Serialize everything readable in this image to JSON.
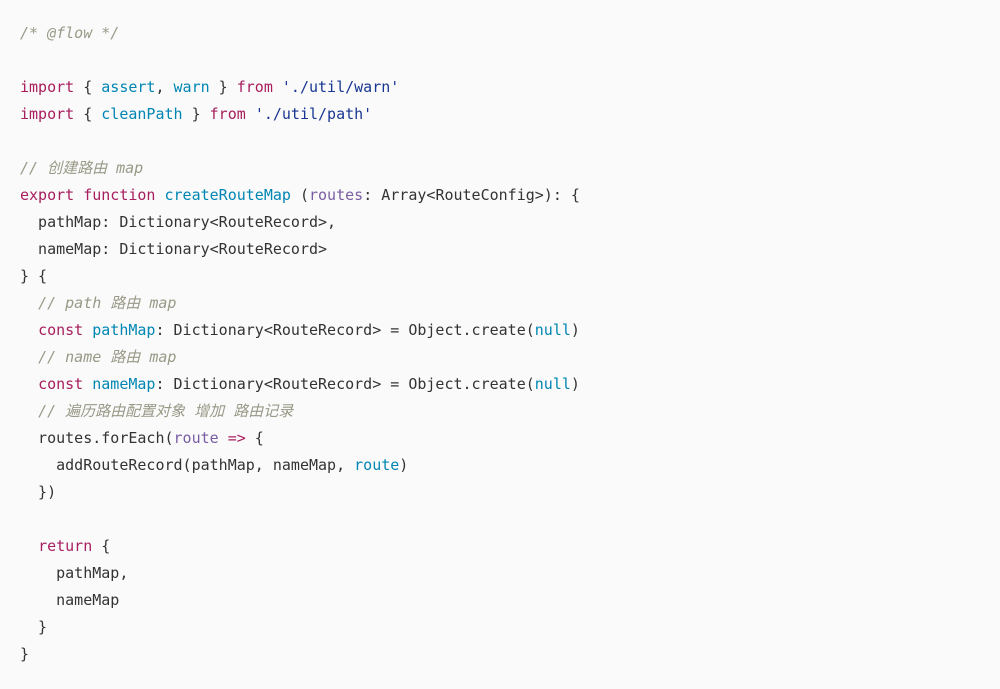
{
  "tokens": [
    {
      "t": "/* @flow */",
      "c": "comment"
    },
    {
      "t": "\n\n"
    },
    {
      "t": "import",
      "c": "keyword"
    },
    {
      "t": " { "
    },
    {
      "t": "assert",
      "c": "function"
    },
    {
      "t": ", "
    },
    {
      "t": "warn",
      "c": "function"
    },
    {
      "t": " } "
    },
    {
      "t": "from",
      "c": "keyword"
    },
    {
      "t": " "
    },
    {
      "t": "'./util/warn'",
      "c": "string"
    },
    {
      "t": "\n"
    },
    {
      "t": "import",
      "c": "keyword"
    },
    {
      "t": " { "
    },
    {
      "t": "cleanPath",
      "c": "function"
    },
    {
      "t": " } "
    },
    {
      "t": "from",
      "c": "keyword"
    },
    {
      "t": " "
    },
    {
      "t": "'./util/path'",
      "c": "string"
    },
    {
      "t": "\n\n"
    },
    {
      "t": "// 创建路由 map",
      "c": "comment"
    },
    {
      "t": "\n"
    },
    {
      "t": "export",
      "c": "keyword"
    },
    {
      "t": " "
    },
    {
      "t": "function",
      "c": "keyword"
    },
    {
      "t": " "
    },
    {
      "t": "createRouteMap",
      "c": "function"
    },
    {
      "t": " ("
    },
    {
      "t": "routes",
      "c": "param"
    },
    {
      "t": ": "
    },
    {
      "t": "Array"
    },
    {
      "t": "<"
    },
    {
      "t": "RouteConfig"
    },
    {
      "t": ">): {"
    },
    {
      "t": "\n  pathMap: Dictionary<RouteRecord>,"
    },
    {
      "t": "\n  nameMap: Dictionary<RouteRecord>"
    },
    {
      "t": "\n} {"
    },
    {
      "t": "\n  "
    },
    {
      "t": "// path 路由 map",
      "c": "comment"
    },
    {
      "t": "\n  "
    },
    {
      "t": "const",
      "c": "keyword"
    },
    {
      "t": " "
    },
    {
      "t": "pathMap",
      "c": "function"
    },
    {
      "t": ": Dictionary<RouteRecord> = "
    },
    {
      "t": "Object"
    },
    {
      "t": ".create("
    },
    {
      "t": "null",
      "c": "null"
    },
    {
      "t": ")"
    },
    {
      "t": "\n  "
    },
    {
      "t": "// name 路由 map",
      "c": "comment"
    },
    {
      "t": "\n  "
    },
    {
      "t": "const",
      "c": "keyword"
    },
    {
      "t": " "
    },
    {
      "t": "nameMap",
      "c": "function"
    },
    {
      "t": ": Dictionary<RouteRecord> = "
    },
    {
      "t": "Object"
    },
    {
      "t": ".create("
    },
    {
      "t": "null",
      "c": "null"
    },
    {
      "t": ")"
    },
    {
      "t": "\n  "
    },
    {
      "t": "// 遍历路由配置对象 增加 路由记录",
      "c": "comment"
    },
    {
      "t": "\n  routes.forEach("
    },
    {
      "t": "route",
      "c": "param"
    },
    {
      "t": " "
    },
    {
      "t": "=>",
      "c": "keyword"
    },
    {
      "t": " {"
    },
    {
      "t": "\n    addRouteRecord(pathMap, nameMap, "
    },
    {
      "t": "route",
      "c": "function"
    },
    {
      "t": ")"
    },
    {
      "t": "\n  })"
    },
    {
      "t": "\n\n  "
    },
    {
      "t": "return",
      "c": "keyword"
    },
    {
      "t": " {"
    },
    {
      "t": "\n    pathMap,"
    },
    {
      "t": "\n    nameMap"
    },
    {
      "t": "\n  }"
    },
    {
      "t": "\n}"
    }
  ]
}
